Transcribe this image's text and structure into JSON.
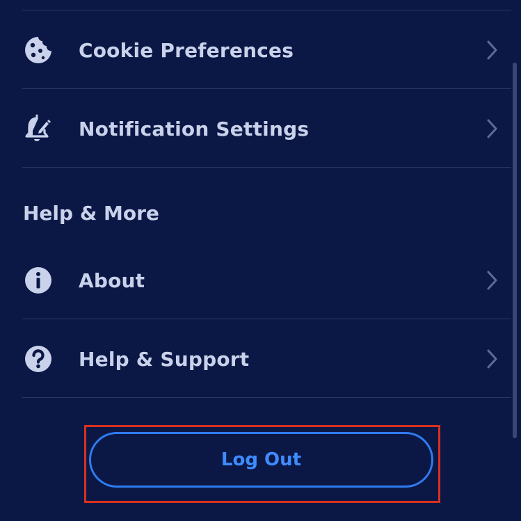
{
  "menu": {
    "items": [
      {
        "label": "Cookie Preferences",
        "icon": "cookie-icon"
      },
      {
        "label": "Notification Settings",
        "icon": "bell-edit-icon"
      }
    ]
  },
  "help_section": {
    "title": "Help & More",
    "items": [
      {
        "label": "About",
        "icon": "info-icon"
      },
      {
        "label": "Help & Support",
        "icon": "question-icon"
      }
    ]
  },
  "logout": {
    "label": "Log Out"
  },
  "colors": {
    "background": "#0b1846",
    "text": "#c9d2ea",
    "divider": "#2a3768",
    "accent": "#2f7cf0",
    "highlight": "#d9301f"
  }
}
